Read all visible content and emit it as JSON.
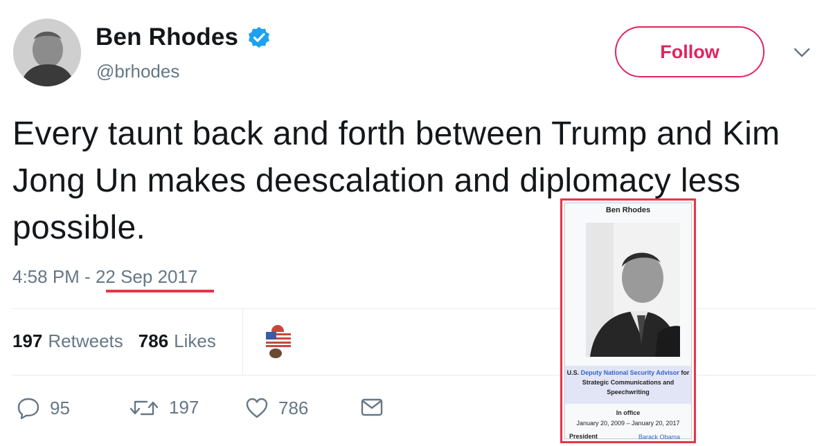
{
  "user": {
    "display_name": "Ben Rhodes",
    "handle": "@brhodes",
    "verified": true
  },
  "follow_button": {
    "label": "Follow"
  },
  "tweet": {
    "text": "Every taunt back and forth between Trump and Kim Jong Un makes deescalation and diplomacy less possible.",
    "time": "4:58 PM",
    "separator": " - ",
    "date": "22 Sep 2017"
  },
  "stats": {
    "retweets_count": "197",
    "retweets_label": "Retweets",
    "likes_count": "786",
    "likes_label": "Likes"
  },
  "actions": {
    "reply_count": "95",
    "retweet_count": "197",
    "like_count": "786"
  },
  "infobox": {
    "title": "Ben Rhodes",
    "role_prefix": "U.S. ",
    "role_link": "Deputy National Security Advisor",
    "role_suffix": " for Strategic Communications and Speechwriting",
    "in_office_label": "In office",
    "term": "January 20, 2009 – January 20, 2017",
    "president_label": "President",
    "president_value": "Barack Obama"
  },
  "colors": {
    "accent_red": "#e0245e",
    "annotation_red": "#e8334a",
    "verified_blue": "#1da1f2",
    "secondary_text": "#657786",
    "link_blue": "#3366cc"
  },
  "icons": [
    "verified-badge-icon",
    "chevron-down-icon",
    "reply-icon",
    "retweet-icon",
    "heart-icon",
    "envelope-icon"
  ]
}
